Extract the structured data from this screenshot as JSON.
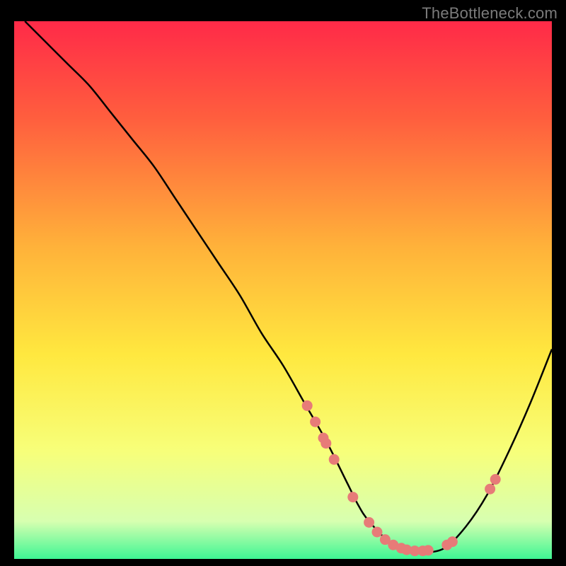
{
  "watermark": "TheBottleneck.com",
  "colors": {
    "frame": "#000000",
    "watermark_text": "#7b7b7b",
    "curve": "#000000",
    "marker_fill": "#e77b78",
    "gradient_top": "#ff2a48",
    "gradient_mid1": "#ff5e3e",
    "gradient_mid2": "#ffb23a",
    "gradient_mid3": "#ffe83f",
    "gradient_low1": "#f7ff7a",
    "gradient_low2": "#d7ffb0",
    "gradient_bottom": "#3ef694"
  },
  "chart_data": {
    "type": "line",
    "title": "",
    "xlabel": "",
    "ylabel": "",
    "xlim": [
      0,
      100
    ],
    "ylim": [
      0,
      100
    ],
    "series": [
      {
        "name": "curve",
        "x": [
          2,
          6,
          10,
          14,
          18,
          22,
          26,
          30,
          34,
          38,
          42,
          46,
          50,
          54,
          58,
          62,
          64,
          66,
          70,
          74,
          76,
          80,
          84,
          88,
          92,
          96,
          100
        ],
        "y": [
          100,
          96,
          92,
          88,
          83,
          78,
          73,
          67,
          61,
          55,
          49,
          42,
          36,
          29,
          22,
          14,
          10,
          7,
          3,
          1.6,
          1.2,
          2,
          6,
          12,
          20,
          29,
          39
        ]
      }
    ],
    "markers": {
      "name": "points",
      "x": [
        54.5,
        56.0,
        57.5,
        58.0,
        59.5,
        63.0,
        66.0,
        67.5,
        69.0,
        70.5,
        72.0,
        73.0,
        74.5,
        76.0,
        77.0,
        80.5,
        81.5,
        88.5,
        89.5
      ],
      "y": [
        28.5,
        25.5,
        22.5,
        21.5,
        18.5,
        11.5,
        6.8,
        5.0,
        3.6,
        2.6,
        2.0,
        1.7,
        1.5,
        1.5,
        1.6,
        2.6,
        3.2,
        13.0,
        14.8
      ]
    }
  }
}
